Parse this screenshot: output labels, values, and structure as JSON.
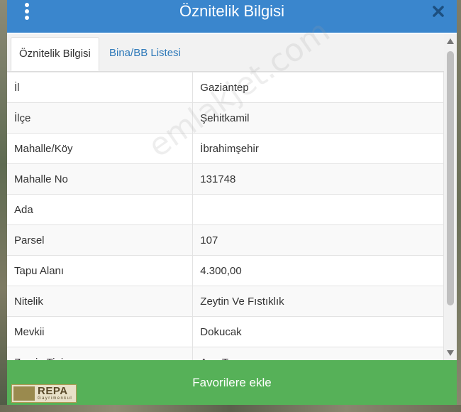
{
  "dialog": {
    "title": "Öznitelik Bilgisi",
    "menu_icon": "vertical-dots-icon",
    "close_icon": "close-icon"
  },
  "tabs": [
    {
      "label": "Öznitelik Bilgisi",
      "active": true
    },
    {
      "label": "Bina/BB Listesi",
      "active": false
    }
  ],
  "attributes": [
    {
      "label": "İl",
      "value": "Gaziantep"
    },
    {
      "label": "İlçe",
      "value": "Şehitkamil"
    },
    {
      "label": "Mahalle/Köy",
      "value": "İbrahimşehir"
    },
    {
      "label": "Mahalle No",
      "value": "131748"
    },
    {
      "label": "Ada",
      "value": ""
    },
    {
      "label": "Parsel",
      "value": "107"
    },
    {
      "label": "Tapu Alanı",
      "value": "4.300,00"
    },
    {
      "label": "Nitelik",
      "value": "Zeytin Ve Fıstıklık"
    },
    {
      "label": "Mevkii",
      "value": "Dokucak"
    },
    {
      "label": "Zemin Tipi",
      "value": "Ana Taşınmaz"
    }
  ],
  "footer": {
    "favorite_label": "Favorilere ekle"
  },
  "watermark": "emlakjet.com",
  "logo": {
    "name": "REPA",
    "subtitle": "Gayrimenkul"
  },
  "colors": {
    "titlebar": "#3a86cd",
    "tab_link": "#2e79b9",
    "favorite_button": "#56b158"
  }
}
